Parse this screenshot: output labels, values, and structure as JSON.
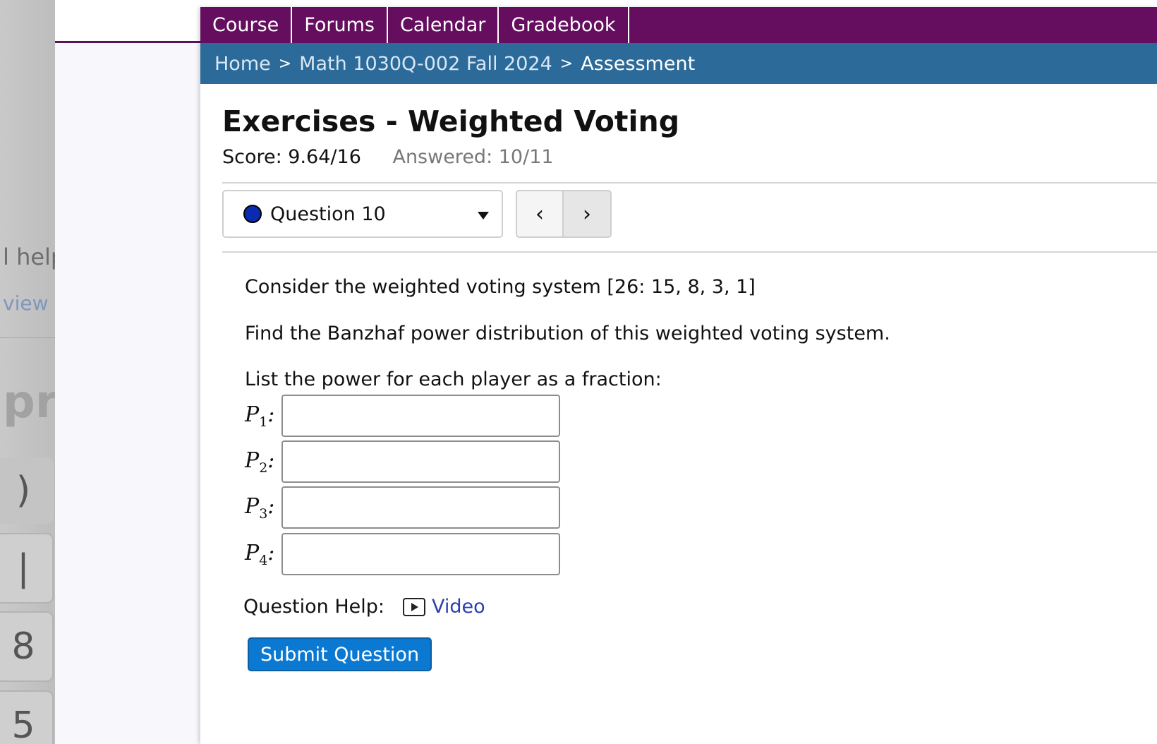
{
  "background_window": {
    "help_text": "l help",
    "view_text": "view t",
    "pro_text": "pro",
    "keys": [
      ")",
      "|",
      "8",
      "5"
    ]
  },
  "nav": {
    "items": [
      "Course",
      "Forums",
      "Calendar",
      "Gradebook"
    ]
  },
  "breadcrumb": {
    "home": "Home",
    "course": "Math 1030Q-002 Fall 2024",
    "current": "Assessment",
    "separator": ">"
  },
  "assessment": {
    "title": "Exercises - Weighted Voting",
    "score": "Score: 9.64/16",
    "answered": "Answered: 10/11"
  },
  "question_selector": {
    "label": "Question 10",
    "status_color": "#0a2bb0",
    "prev_label": "‹",
    "next_label": "›"
  },
  "question": {
    "line1": "Consider the weighted voting system [26: 15, 8, 3, 1]",
    "line2": "Find the Banzhaf power distribution of this weighted voting system.",
    "line3": "List the power for each player as a fraction:",
    "players": [
      {
        "var": "P",
        "sub": "1",
        "value": ""
      },
      {
        "var": "P",
        "sub": "2",
        "value": ""
      },
      {
        "var": "P",
        "sub": "3",
        "value": ""
      },
      {
        "var": "P",
        "sub": "4",
        "value": ""
      }
    ]
  },
  "help": {
    "label": "Question Help:",
    "video_label": "Video"
  },
  "submit": {
    "label": "Submit Question"
  },
  "colors": {
    "nav_bg": "#650d5e",
    "breadcrumb_bg": "#2b6a99",
    "submit_bg": "#0b78d2",
    "link": "#2a3fae"
  }
}
